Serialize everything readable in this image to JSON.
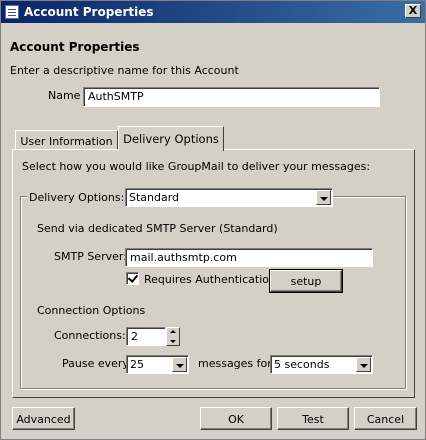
{
  "window": {
    "title": "Account Properties",
    "close_label": "X"
  },
  "header": {
    "heading": "Account Properties",
    "description": "Enter a descriptive name for this Account"
  },
  "name_field": {
    "label": "Name",
    "value": "AuthSMTP"
  },
  "tabs": [
    {
      "label": "User Information",
      "active": false
    },
    {
      "label": "Delivery Options",
      "active": true
    }
  ],
  "delivery": {
    "instruction": "Select how you would like GroupMail to deliver your messages:",
    "options_label": "Delivery Options:",
    "options_value": "Standard",
    "smtp_heading": "Send via dedicated SMTP Server (Standard)",
    "smtp_label": "SMTP Server:",
    "smtp_value": "mail.authsmtp.com",
    "auth_label": "Requires Authentication",
    "auth_checked": true,
    "setup_label": "setup",
    "connection_heading": "Connection Options",
    "connections_label": "Connections:",
    "connections_value": "2",
    "pause_label": "Pause every",
    "pause_value": "25",
    "messages_label": "messages for",
    "duration_value": "5 seconds"
  },
  "buttons": {
    "advanced": "Advanced",
    "ok": "OK",
    "test": "Test",
    "cancel": "Cancel"
  }
}
